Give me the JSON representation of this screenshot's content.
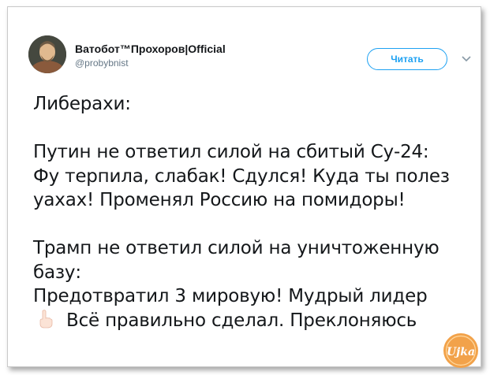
{
  "tweet": {
    "user_name": "Ватобот™Прохоров|Official",
    "user_handle": "@probybnist",
    "follow_label": "Читать",
    "lines_block1": [
      "Либерахи:"
    ],
    "lines_block2": [
      "Путин не ответил силой на сбитый Су-24:",
      "Фу терпила, слабак! Сдулся! Куда ты полез",
      "уахах! Променял Россию на помидоры!"
    ],
    "lines_block3": [
      "Трамп не ответил силой на уничтоженную",
      "базу:",
      "Предотвратил 3 мировую! Мудрый лидер"
    ],
    "last_line": "Всё правильно сделал. Преклоняюсь"
  },
  "icons": {
    "hand": "raised-index-finger-icon",
    "chevron": "chevron-down-icon"
  },
  "watermark": {
    "text": "Ujka"
  },
  "colors": {
    "accent": "#1da1f2",
    "text": "#14171a",
    "muted": "#657786",
    "watermark": "#f2a24a"
  }
}
